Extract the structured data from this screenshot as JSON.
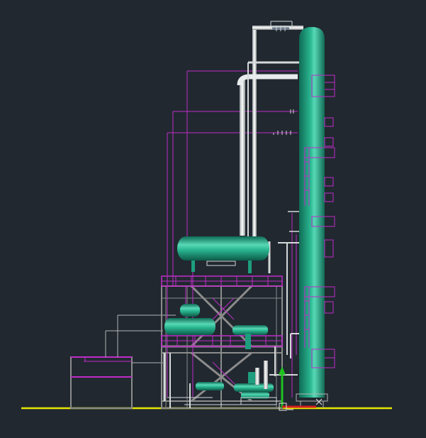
{
  "app": {
    "view_description": "",
    "background_color": "#212830"
  },
  "colors": {
    "equipment": "#1e9e7e",
    "equipment_highlight": "#52d8b4",
    "piping": "#d4d8d8",
    "annotation": "#c02cc8",
    "structure": "#8c8c8c",
    "ground": "#e6e600",
    "thin_line": "#b4b4b4",
    "ucs_x": "#d02020",
    "ucs_y": "#20c020"
  },
  "icons": {
    "ucs": "ucs-icon"
  }
}
